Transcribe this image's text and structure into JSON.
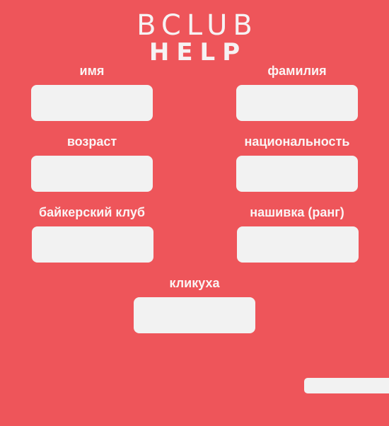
{
  "logo": {
    "top": "BCLUB",
    "bottom": "HELP"
  },
  "form": {
    "first_name": {
      "label": "имя",
      "value": "",
      "placeholder": ""
    },
    "last_name": {
      "label": "фамилия",
      "value": "",
      "placeholder": ""
    },
    "age": {
      "label": "возраст",
      "value": "",
      "placeholder": ""
    },
    "nationality": {
      "label": "национальность",
      "value": "",
      "placeholder": ""
    },
    "biker_club": {
      "label": "байкерский клуб",
      "value": "",
      "placeholder": ""
    },
    "patch_rank": {
      "label": "нашивка (ранг)",
      "value": "",
      "placeholder": ""
    },
    "nickname": {
      "label": "кликуха",
      "value": "",
      "placeholder": ""
    }
  },
  "colors": {
    "background": "#ee555a",
    "input_fill": "#f2f2f2",
    "text": "#ffffff"
  }
}
